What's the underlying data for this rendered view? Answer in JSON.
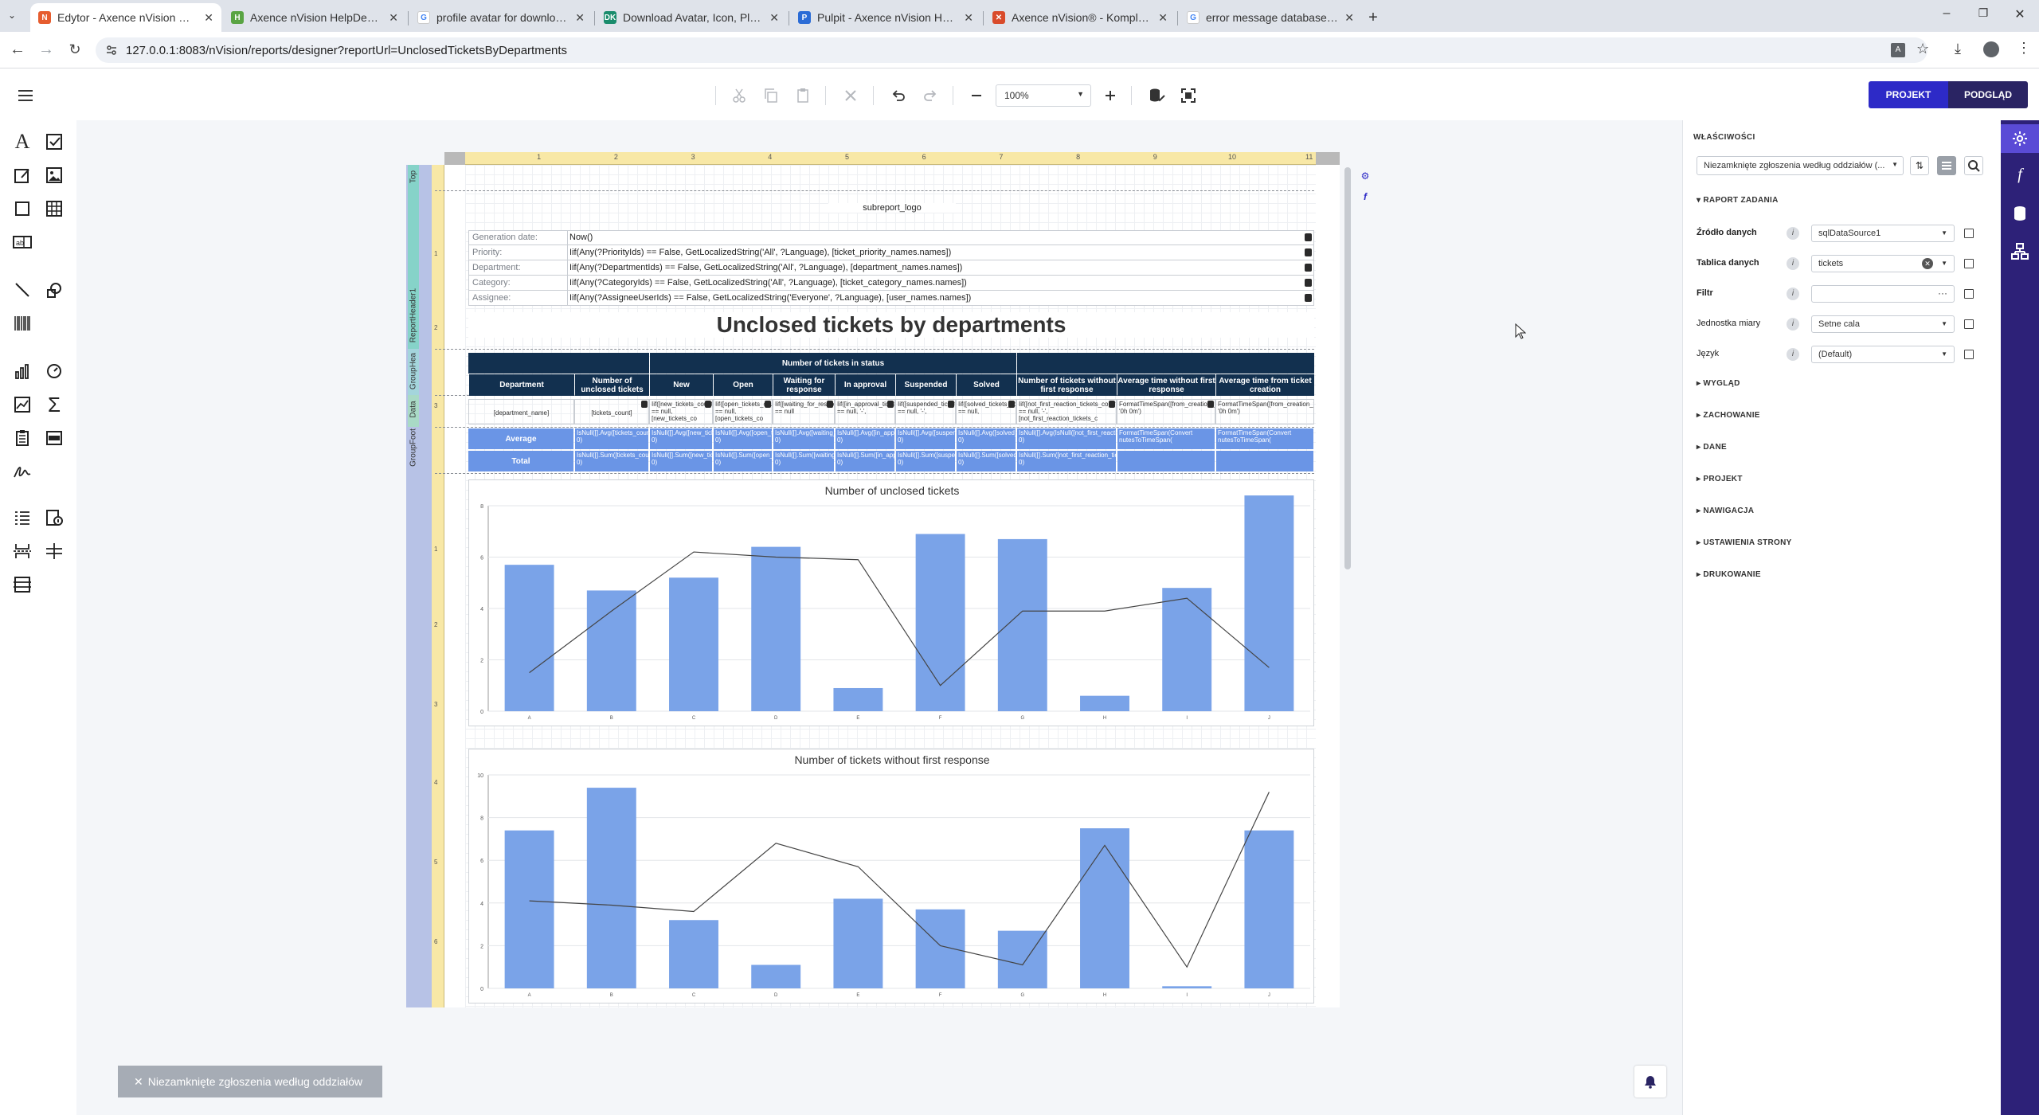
{
  "browser": {
    "tabs": [
      {
        "title": "Edytor - Axence nVision Raport",
        "active": true
      },
      {
        "title": "Axence nVision HelpDesk @ VT"
      },
      {
        "title": "profile avatar for download 96"
      },
      {
        "title": "Download Avatar, Icon, Placeh"
      },
      {
        "title": "Pulpit - Axence nVision HelpDe"
      },
      {
        "title": "Axence nVision® - Kompleksow"
      },
      {
        "title": "error message database - Szuk"
      }
    ],
    "url": "127.0.0.1:8083/nVision/reports/designer?reportUrl=UnclosedTicketsByDepartments"
  },
  "toolbar": {
    "zoom": "100%",
    "btn_design": "PROJEKT",
    "btn_preview": "PODGLĄD"
  },
  "report": {
    "logo_text": "subreport_logo",
    "params": [
      {
        "label": "Generation date:",
        "value": "Now()"
      },
      {
        "label": "Priority:",
        "value": "Iif(Any(?PriorityIds) == False, GetLocalizedString('All', ?Language), [ticket_priority_names.names])"
      },
      {
        "label": "Department:",
        "value": "Iif(Any(?DepartmentIds) == False, GetLocalizedString('All', ?Language), [department_names.names])"
      },
      {
        "label": "Category:",
        "value": "Iif(Any(?CategoryIds) == False, GetLocalizedString('All', ?Language), [ticket_category_names.names])"
      },
      {
        "label": "Assignee:",
        "value": "Iif(Any(?AssigneeUserIds) == False, GetLocalizedString('Everyone', ?Language), [user_names.names])"
      }
    ],
    "title": "Unclosed tickets by departments",
    "group_header": "Number of tickets in status",
    "columns": [
      "Department",
      "Number of unclosed tickets",
      "New",
      "Open",
      "Waiting for response",
      "In approval",
      "Suspended",
      "Solved",
      "Number of tickets without first response",
      "Average time without first response",
      "Average time from ticket creation"
    ],
    "data_row": [
      "[department_name]",
      "[tickets_count]",
      "Iif([new_tickets_count] == null, [new_tickets_co",
      "Iif([open_tickets_count] == null, [open_tickets_co",
      "Iif([waiting_for_response_tickets_count] == null",
      "Iif([in_approval_tickets_count] == null, '-',",
      "Iif([suspended_tickets_count] == null, '-',",
      "Iif([solved_tickets_count] == null,",
      "Iif([not_first_reaction_tickets_count] == null, '-', [not_first_reaction_tickets_c",
      "FormatTimeSpan([from_creation_without_reaction_time_avg], '0h 0m')",
      "FormatTimeSpan([from_creation_time_avg], '0h 0m')"
    ],
    "avg_label": "Average",
    "avg_row": [
      "IsNull([].Avg([tickets_count]), 0)",
      "IsNull([].Avg([new_tickets_count]), 0)",
      "IsNull([].Avg([open_tickets_count]), 0)",
      "IsNull([].Avg([waiting_for_response]), 0)",
      "IsNull([].Avg([in_approval_tickets]), 0)",
      "IsNull([].Avg([suspended_tickets]), 0)",
      "IsNull([].Avg([solved_tickets]), 0)",
      "IsNull([].Avg(IsNull([not_first_reaction_tickets_count], 0)",
      "FormatTimeSpan(Convert nutesToTimeSpan(",
      "FormatTimeSpan(Convert nutesToTimeSpan("
    ],
    "total_label": "Total",
    "total_row": [
      "IsNull([].Sum([tickets_count]), 0)",
      "IsNull([].Sum([new_tickets_count]), 0)",
      "IsNull([].Sum([open_tickets_count]), 0)",
      "IsNull([].Sum([waiting_for_response]), 0)",
      "IsNull([].Sum([in_approval_tickets]), 0)",
      "IsNull([].Sum([suspended_tickets]), 0)",
      "IsNull([].Sum([solved_tickets]), 0)",
      "IsNull([].Sum([not_first_reaction_tickets_count]), 0)",
      "",
      ""
    ],
    "bands": [
      "Top",
      "ReportHeader1",
      "GroupHea",
      "Data",
      "GroupFoot"
    ],
    "ruler_top": [
      "1",
      "2",
      "3",
      "4",
      "5",
      "6",
      "7",
      "8",
      "9",
      "10",
      "11"
    ],
    "ruler_left": [
      "1",
      "2",
      "3",
      "1",
      "2",
      "3",
      "4",
      "5",
      "6"
    ]
  },
  "chart_data": [
    {
      "type": "bar",
      "title": "Number of unclosed tickets",
      "categories": [
        "A",
        "B",
        "C",
        "D",
        "E",
        "F",
        "G",
        "H",
        "I",
        "J"
      ],
      "ylim": [
        0,
        8
      ],
      "yticks": [
        "0",
        "2",
        "4",
        "6",
        "8"
      ],
      "series": [
        {
          "kind": "bar",
          "color": "#7aa3e8",
          "values": [
            5.7,
            4.7,
            5.2,
            6.4,
            0.9,
            6.9,
            6.7,
            0.6,
            4.8,
            8.4
          ]
        },
        {
          "kind": "line",
          "color": "#444444",
          "values": [
            1.5,
            3.9,
            6.2,
            6.0,
            5.9,
            1.0,
            3.9,
            3.9,
            4.4,
            1.7
          ]
        }
      ]
    },
    {
      "type": "bar",
      "title": "Number of tickets without first response",
      "categories": [
        "A",
        "B",
        "C",
        "D",
        "E",
        "F",
        "G",
        "H",
        "I",
        "J"
      ],
      "ylim": [
        0,
        10
      ],
      "yticks": [
        "0",
        "2",
        "4",
        "6",
        "8",
        "10"
      ],
      "series": [
        {
          "kind": "bar",
          "color": "#7aa3e8",
          "values": [
            7.4,
            9.4,
            3.2,
            1.1,
            4.2,
            3.7,
            2.7,
            7.5,
            0.1,
            7.4
          ]
        },
        {
          "kind": "line",
          "color": "#444444",
          "values": [
            4.1,
            3.9,
            3.6,
            6.8,
            5.7,
            2.0,
            1.1,
            6.7,
            1.0,
            9.2
          ]
        }
      ]
    }
  ],
  "properties": {
    "title": "WŁAŚCIWOŚCI",
    "selector": "Niezamknięte zgłoszenia według oddziałów (...",
    "section_main": "RAPORT ZADANIA",
    "rows": [
      {
        "label": "Źródło danych",
        "value": "sqlDataSource1",
        "bold": true
      },
      {
        "label": "Tablica danych",
        "value": "tickets",
        "bold": true
      },
      {
        "label": "Filtr",
        "value": "",
        "bold": true
      },
      {
        "label": "Jednostka miary",
        "value": "Setne cala",
        "bold": false
      },
      {
        "label": "Język",
        "value": "(Default)",
        "bold": false
      }
    ],
    "sections": [
      "WYGLĄD",
      "ZACHOWANIE",
      "DANE",
      "PROJEKT",
      "NAWIGACJA",
      "USTAWIENIA STRONY",
      "DRUKOWANIE"
    ]
  },
  "footer_tab": "Niezamknięte zgłoszenia według oddziałów"
}
